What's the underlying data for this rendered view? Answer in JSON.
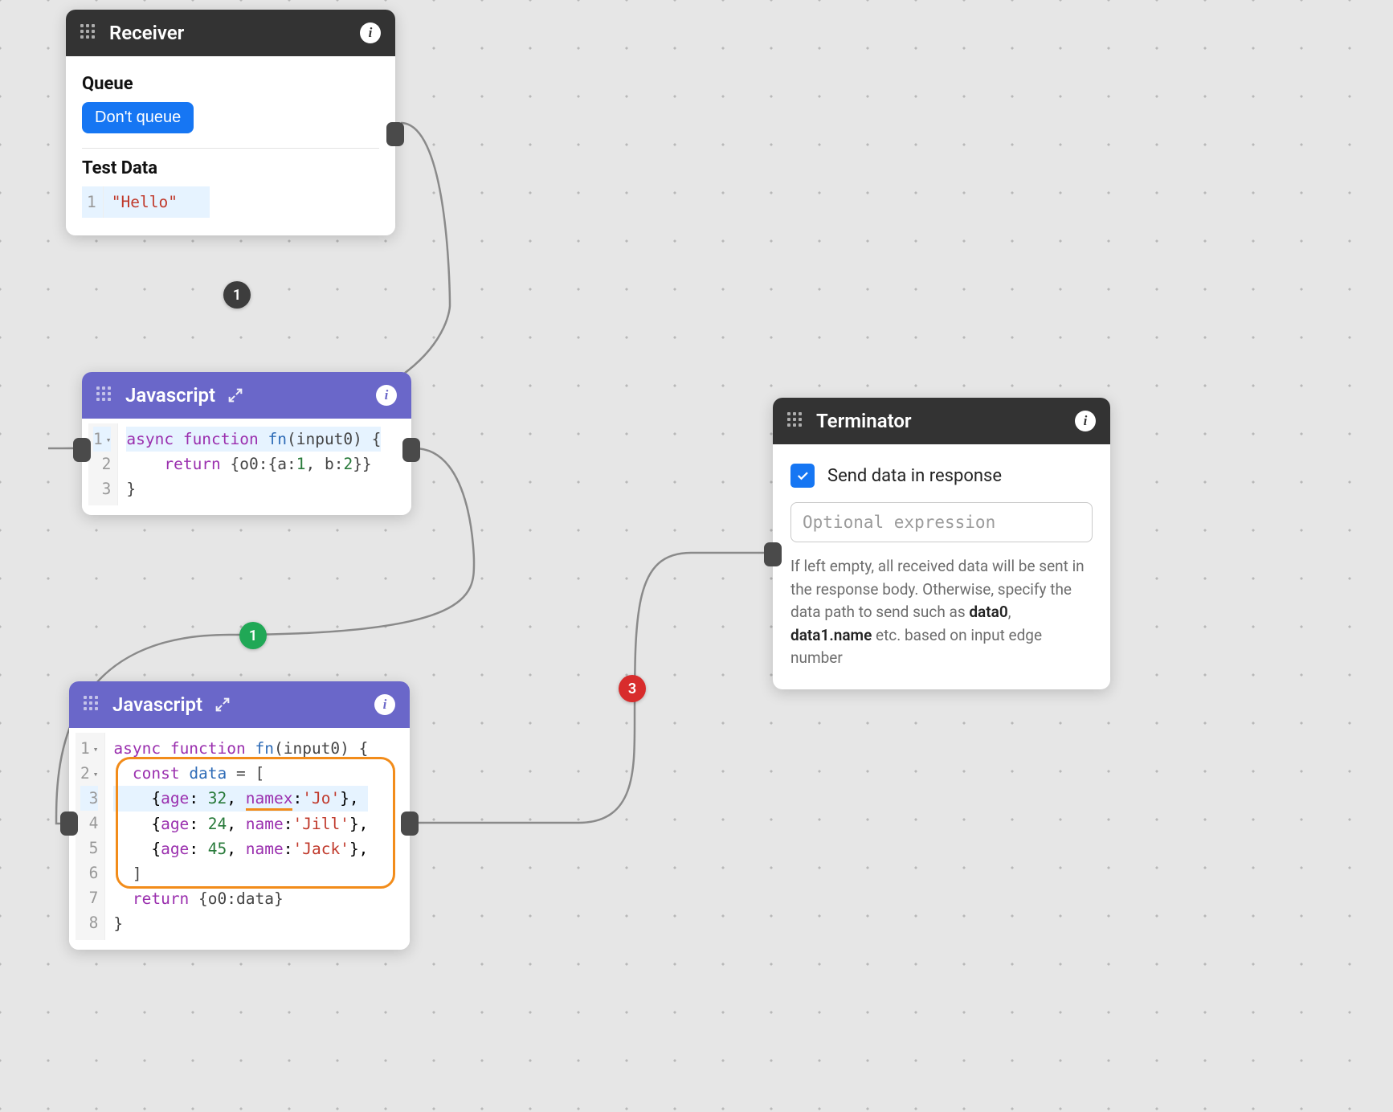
{
  "nodes": {
    "receiver": {
      "title": "Receiver",
      "queue_label": "Queue",
      "queue_button": "Don't queue",
      "testdata_label": "Test Data",
      "testdata_value": "\"Hello\""
    },
    "js1": {
      "title": "Javascript",
      "code": {
        "line1": {
          "async": "async",
          "function": "function",
          "fn": "fn",
          "args": "(input0)",
          "brace": " {"
        },
        "line2": {
          "return": "return",
          "obj": " {o0:{a:",
          "v1": "1",
          "sep": ", b:",
          "v2": "2",
          "end": "}}"
        },
        "line3": {
          "brace": "}"
        }
      }
    },
    "js2": {
      "title": "Javascript",
      "code": {
        "l1": {
          "async": "async",
          "function": "function",
          "fn": "fn",
          "args": "(input0)",
          "brace": " {"
        },
        "l2": {
          "const": "const",
          "data": "data",
          "eq": " = ["
        },
        "l3": {
          "age": "age",
          "v": "32",
          "namex": "namex",
          "s": "'Jo'"
        },
        "l4": {
          "age": "age",
          "v": "24",
          "name": "name",
          "s": "'Jill'"
        },
        "l5": {
          "age": "age",
          "v": "45",
          "name": "name",
          "s": "'Jack'"
        },
        "l6": {
          "close": "]"
        },
        "l7": {
          "return": "return",
          "obj": " {o0:data}"
        },
        "l8": {
          "brace": "}"
        }
      }
    },
    "terminator": {
      "title": "Terminator",
      "checkbox_label": "Send data in response",
      "checkbox_checked": true,
      "input_placeholder": "Optional expression",
      "help_prefix": "If left empty, all received data will be sent in the response body. Otherwise, specify the data path to send such as ",
      "help_code1": "data0",
      "help_sep": ", ",
      "help_code2": "data1.name",
      "help_suffix": " etc. based on input edge number"
    }
  },
  "edges": {
    "b1": "1",
    "b2": "1",
    "b3": "3"
  }
}
